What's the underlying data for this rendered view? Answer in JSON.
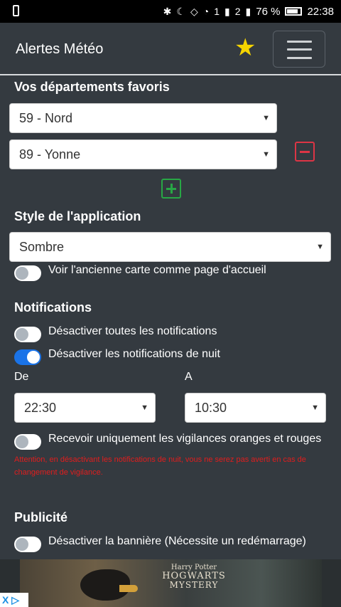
{
  "status_bar": {
    "battery": "76 %",
    "time": "22:38",
    "sim1_badge": "1",
    "sim2_badge": "2",
    "icons": [
      "phone-icon",
      "bluetooth-icon",
      "do-not-disturb-icon",
      "vibrate-icon",
      "wifi-icon",
      "signal-icon",
      "battery-icon"
    ]
  },
  "navbar": {
    "title": "Alertes Météo",
    "star_glyph": "★",
    "icons": [
      "star-icon",
      "hamburger-menu-icon"
    ]
  },
  "favorites": {
    "title": "Vos départements favoris",
    "items": [
      {
        "value": "59 - Nord"
      },
      {
        "value": "89 - Yonne"
      }
    ]
  },
  "style": {
    "title": "Style de l'application",
    "value": "Sombre",
    "old_map_label": "Voir l'ancienne carte comme page d'accueil",
    "old_map_enabled": false
  },
  "notifications": {
    "title": "Notifications",
    "disable_all_label": "Désactiver toutes les notifications",
    "disable_all_enabled": false,
    "disable_night_label": "Désactiver les notifications de nuit",
    "disable_night_enabled": true,
    "from_label": "De",
    "from_value": "22:30",
    "to_label": "A",
    "to_value": "10:30",
    "orange_red_label": "Recevoir uniquement les vigilances oranges et rouges",
    "orange_red_enabled": false,
    "warning": "Attention, en désactivant les notifications de nuit, vous ne serez pas averti en cas de changement de vigilance."
  },
  "ads": {
    "title": "Publicité",
    "disable_banner_label": "Désactiver la bannière (Nécessite un redémarrage)",
    "disable_banner_enabled": false,
    "banner_brand_line1": "Harry Potter",
    "banner_brand_line2": "HOGWARTS",
    "banner_brand_line3": "MYSTERY",
    "adchoices_label": "X ▷"
  },
  "colors": {
    "background": "#343a40",
    "toggle_on": "#1a73e8",
    "danger": "#dc3545",
    "success": "#28a745",
    "star": "#f5d400",
    "warning_text": "#e11d1d"
  }
}
